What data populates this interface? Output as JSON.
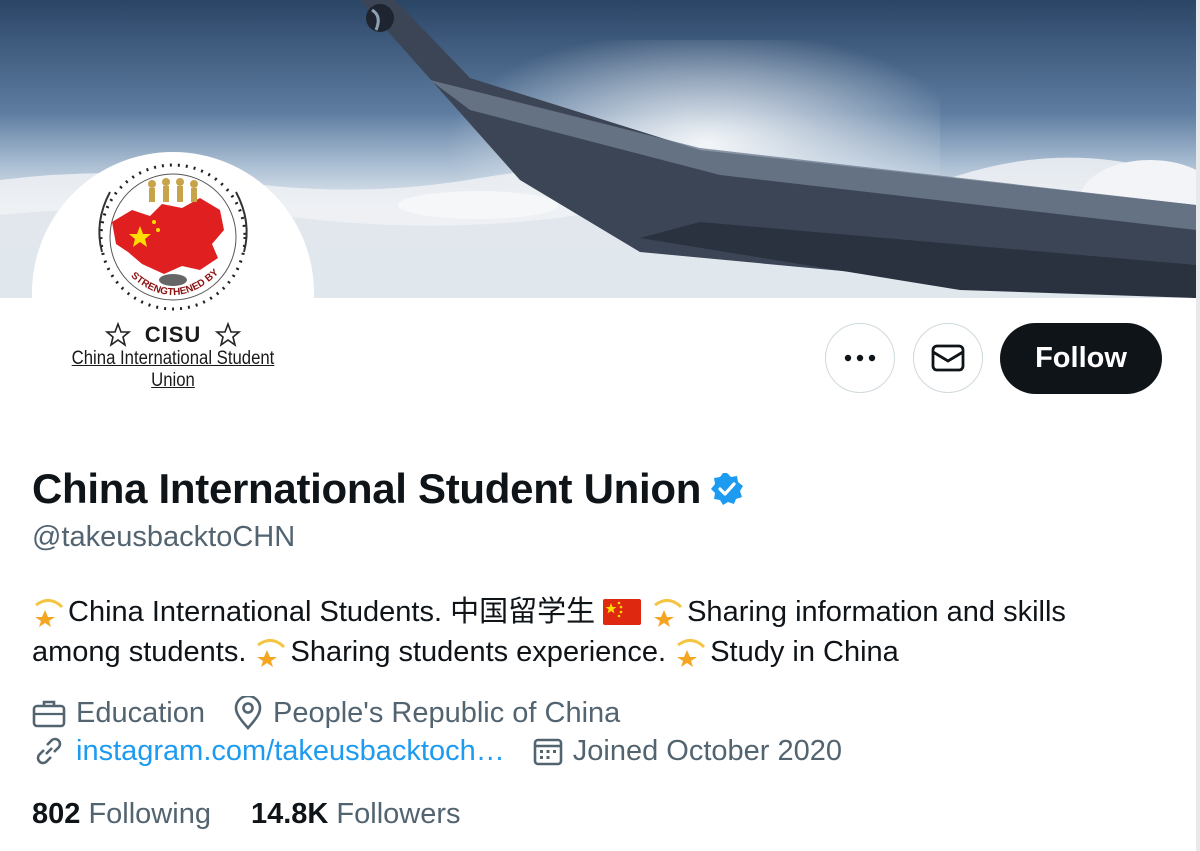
{
  "profile": {
    "display_name": "China International Student Union",
    "handle": "@takeusbacktoCHN",
    "bio": {
      "part1": "China International Students. 中国留学生",
      "part2": "Sharing information and skills among students.",
      "part3": "Sharing students experience.",
      "part4": "Study in China"
    },
    "category": "Education",
    "location": "People's Republic of China",
    "website": "instagram.com/takeusbacktoch…",
    "joined": "Joined October 2020"
  },
  "avatar": {
    "acronym": "CISU",
    "name": "China International Student Union",
    "slogan": "STRENGTHENED BY DIVERSITY"
  },
  "actions": {
    "follow_label": "Follow"
  },
  "stats": {
    "following_count": "802",
    "following_label": "Following",
    "followers_count": "14.8K",
    "followers_label": "Followers"
  },
  "colors": {
    "primary_text": "#0f1419",
    "secondary_text": "#536471",
    "link": "#1d9bf0",
    "verified": "#1d9bf0",
    "follow_button_bg": "#0f1419"
  },
  "icons": [
    "more-icon",
    "envelope-icon",
    "verified-badge-icon",
    "briefcase-icon",
    "location-pin-icon",
    "link-icon",
    "calendar-icon",
    "dizzy-star-icon",
    "china-flag-icon"
  ]
}
